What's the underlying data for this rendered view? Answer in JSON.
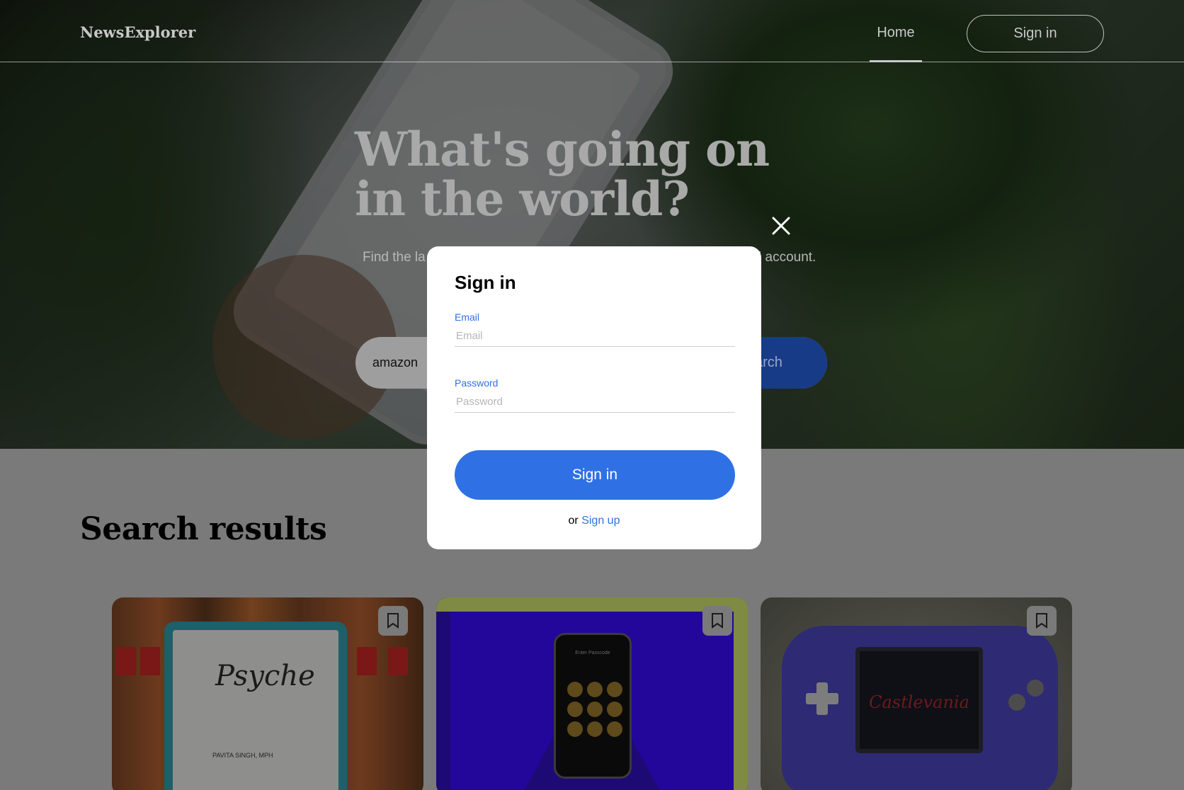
{
  "header": {
    "logo": "NewsExplorer",
    "nav_home": "Home",
    "nav_signin": "Sign in"
  },
  "hero": {
    "title": "What's going on in the world?",
    "subtitle_left": "Find the la",
    "subtitle_right": "l account.",
    "search_value": "amazon",
    "search_button_partial": "arch"
  },
  "results": {
    "title": "Search results",
    "cards": [
      {
        "image": "kindle-ereader-law-books",
        "ereader_title": "Psyche",
        "ereader_author": "PAVITA SINGH, MPH"
      },
      {
        "image": "smartphone-passcode-purple",
        "phone_label": "Enter Passcode"
      },
      {
        "image": "gameboy-advance-castlevania",
        "game_logo": "Castlevania"
      }
    ]
  },
  "modal": {
    "title": "Sign in",
    "email_label": "Email",
    "email_placeholder": "Email",
    "password_label": "Password",
    "password_placeholder": "Password",
    "submit_label": "Sign in",
    "alt_prefix": "or",
    "alt_link": "Sign up"
  },
  "colors": {
    "accent_blue": "#2f71e5",
    "modal_bg": "#ffffff"
  },
  "icons": {
    "close": "close-icon",
    "bookmark": "bookmark-icon"
  }
}
